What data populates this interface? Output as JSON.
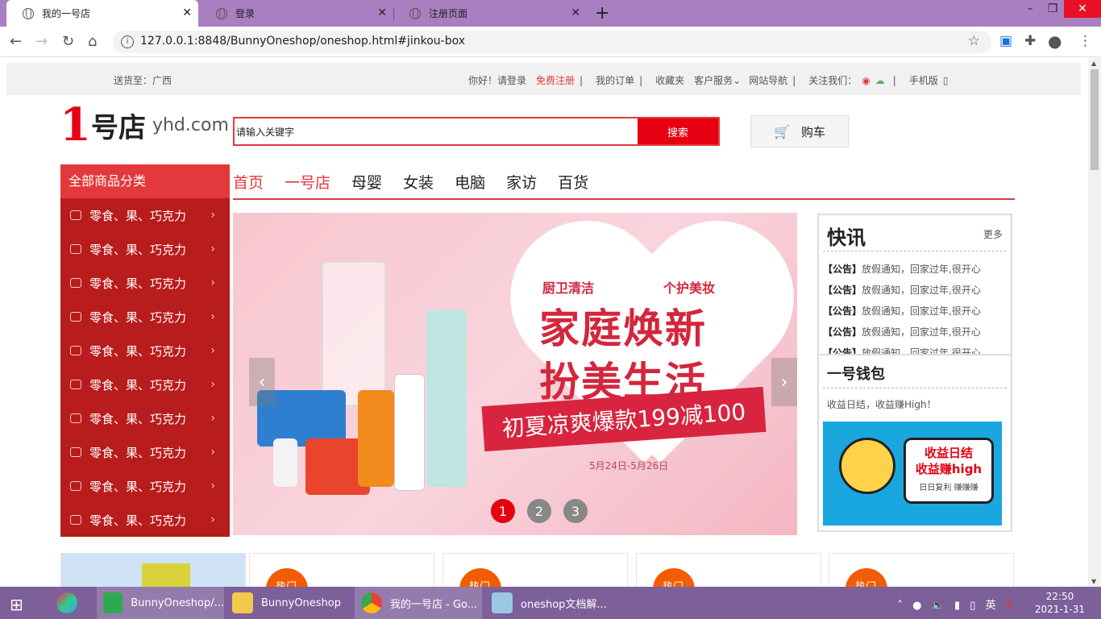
{
  "browser": {
    "tabs": [
      {
        "title": "我的一号店",
        "active": true
      },
      {
        "title": "登录",
        "active": false
      },
      {
        "title": "注册页面",
        "active": false
      }
    ],
    "url": "127.0.0.1:8848/BunnyOneshop/oneshop.html#jinkou-box"
  },
  "topbar": {
    "ship_to": "送货至：广西",
    "greeting": "你好！请登录",
    "register": "免费注册",
    "orders": "我的订单",
    "favorites": "收藏夹",
    "service": "客户服务",
    "sitenav": "网站导航",
    "follow": "关注我们：",
    "mobile": "手机版",
    "sep": "|"
  },
  "logo": {
    "mark": "1号店",
    "yi": "1",
    "hd": "号店",
    "domain": "yhd.com"
  },
  "search": {
    "placeholder": "请输入关键字",
    "button": "搜索"
  },
  "cart": {
    "label": "购车"
  },
  "category_header": "全部商品分类",
  "categories": [
    "零食、果、巧克力",
    "零食、果、巧克力",
    "零食、果、巧克力",
    "零食、果、巧克力",
    "零食、果、巧克力",
    "零食、果、巧克力",
    "零食、果、巧克力",
    "零食、果、巧克力",
    "零食、果、巧克力",
    "零食、果、巧克力"
  ],
  "nav": [
    "首页",
    "一号店",
    "母婴",
    "女装",
    "电脑",
    "家访",
    "百货"
  ],
  "banner": {
    "sub_left": "厨卫清洁",
    "sub_right": "个护美妆",
    "title_line1": "家庭焕新",
    "title_line2": "扮美生活",
    "ribbon": "初夏凉爽爆款199减100",
    "date": "5月24日-5月26日",
    "prev": "‹",
    "next": "›",
    "dots": [
      "1",
      "2",
      "3"
    ],
    "active_dot": 0
  },
  "news": {
    "title": "快讯",
    "more": "更多",
    "tag": "【公告】",
    "items": [
      "放假通知，回家过年,很开心",
      "放假通知，回家过年,很开心",
      "放假通知，回家过年,很开心",
      "放假通知，回家过年,很开心",
      "放假通知，回家过年,很开心"
    ]
  },
  "wallet": {
    "title": "一号钱包",
    "subtitle": "收益日结，收益赚High！",
    "img_line1": "收益日结",
    "img_line2": "收益赚high",
    "img_line3": "日日复利 赚赚赚"
  },
  "cards": {
    "badge": "热门"
  },
  "taskbar": {
    "items": [
      {
        "label": "BunnyOneshop/..."
      },
      {
        "label": "BunnyOneshop"
      },
      {
        "label": "我的一号店 - Go..."
      },
      {
        "label": "oneshop文档解..."
      }
    ],
    "ime": "英",
    "time": "22:50",
    "date": "2021-1-31"
  },
  "colors": {
    "accent": "#e4393c",
    "brand": "#e60012",
    "tabbar": "#a97fc1",
    "taskbar": "#7d5f9a"
  }
}
